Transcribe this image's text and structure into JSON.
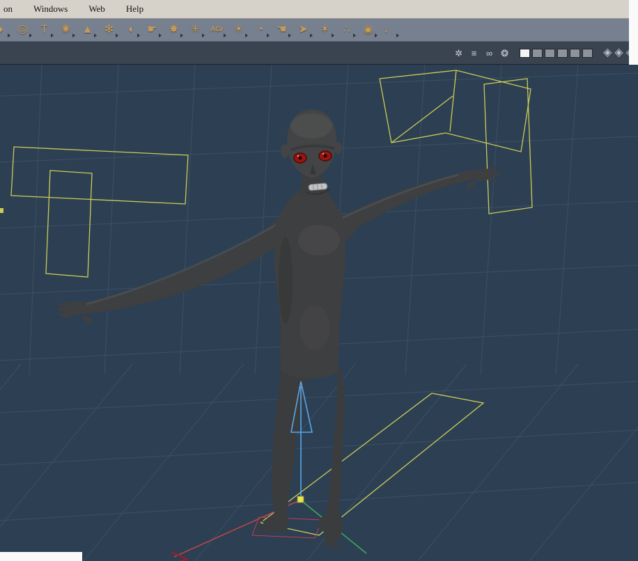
{
  "menu_bar": {
    "items": [
      {
        "label": "on"
      },
      {
        "label": "Windows"
      },
      {
        "label": "Web"
      },
      {
        "label": "Help"
      }
    ]
  },
  "toolbar": {
    "icons": [
      {
        "name": "brush-tip-tool-icon",
        "glyph": "◗"
      },
      {
        "name": "target-tool-icon",
        "glyph": "◎"
      },
      {
        "name": "text-tool-icon",
        "glyph": "T"
      },
      {
        "name": "fur-ball-tool-icon",
        "glyph": "✺"
      },
      {
        "name": "terrain-tool-icon",
        "glyph": "▲"
      },
      {
        "name": "flower-tool-icon",
        "glyph": "✻"
      },
      {
        "name": "mound-tool-icon",
        "glyph": "◖"
      },
      {
        "name": "finger-tool-icon",
        "glyph": "☛"
      },
      {
        "name": "splash-tool-icon",
        "glyph": "✸"
      },
      {
        "name": "starburst-tool-icon",
        "glyph": "✳"
      },
      {
        "name": "agr-tool-icon",
        "glyph": "AGr"
      },
      {
        "name": "landscape-tool-icon",
        "glyph": "☀"
      },
      {
        "name": "shell-tool-icon",
        "glyph": "◔"
      },
      {
        "name": "hand-tool-icon",
        "glyph": "☚"
      },
      {
        "name": "dart-tool-icon",
        "glyph": "➤"
      },
      {
        "name": "spider-tool-icon",
        "glyph": "✶"
      },
      {
        "name": "nodes-tool-icon",
        "glyph": "∴"
      },
      {
        "name": "ring-tool-icon",
        "glyph": "◉"
      },
      {
        "name": "bone-tool-icon",
        "glyph": "♩"
      }
    ]
  },
  "display_bar": {
    "icons": [
      {
        "name": "particles-display-icon",
        "glyph": "✲"
      },
      {
        "name": "bars-display-icon",
        "glyph": "≡"
      },
      {
        "name": "binoculars-display-icon",
        "glyph": "∞"
      },
      {
        "name": "wheel-display-icon",
        "glyph": "❂"
      }
    ],
    "shading_modes": [
      {
        "name": "shading-mode-selected",
        "selected": true
      },
      {
        "name": "shading-mode-2",
        "selected": false
      },
      {
        "name": "shading-mode-3",
        "selected": false
      },
      {
        "name": "shading-mode-4",
        "selected": false
      },
      {
        "name": "shading-mode-5",
        "selected": false
      },
      {
        "name": "shading-mode-6",
        "selected": false
      }
    ],
    "shield_icons": [
      {
        "name": "shield-display-icon-1",
        "glyph": "◈"
      },
      {
        "name": "shield-display-icon-2",
        "glyph": "◈"
      },
      {
        "name": "shield-display-icon-3",
        "glyph": "◈"
      }
    ]
  },
  "viewport": {
    "content": "3d-character-model-t-pose",
    "manipulator": {
      "axis": "Y",
      "color": "#5aa7e8"
    },
    "character": {
      "body_color": "#3e3f40",
      "eye_color": "#9c1410"
    }
  },
  "colors": {
    "accent_yellow": "#d9d957",
    "axis_red": "#c14848",
    "axis_green": "#3fae5a",
    "viewport_bg": "#2d3f53",
    "grid": "#41586e",
    "toolbar_icon": "#c59a58"
  }
}
